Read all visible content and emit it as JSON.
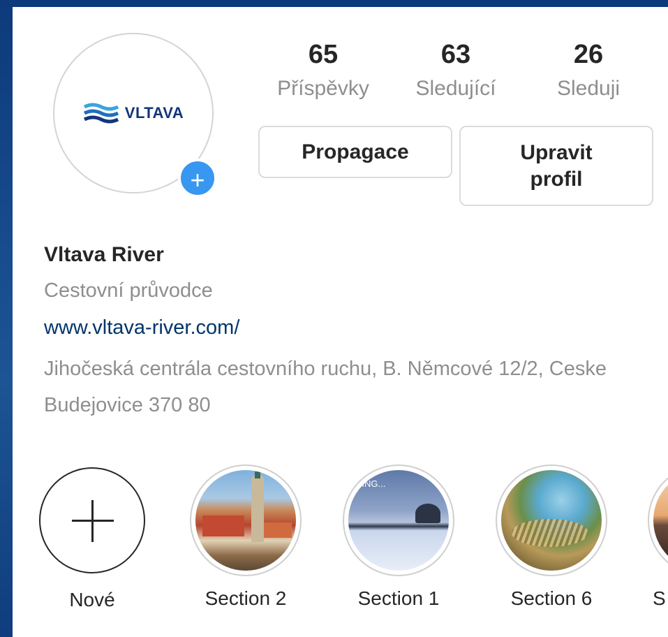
{
  "profile": {
    "logo_text": "VLTAVA",
    "name": "Vltava River",
    "category": "Cestovní průvodce",
    "website": "www.vltava-river.com/",
    "address": "Jihočeská centrála cestovního ruchu, B. Němcové 12/2, Ceske Budejovice 370 80"
  },
  "stats": [
    {
      "value": "65",
      "label": "Příspěvky"
    },
    {
      "value": "63",
      "label": "Sledující"
    },
    {
      "value": "26",
      "label": "Sleduji"
    }
  ],
  "buttons": {
    "promote": "Propagace",
    "edit_profile": "Upravit profil"
  },
  "highlights": [
    {
      "label": "Nové",
      "icon": "plus-icon"
    },
    {
      "label": "Section 2"
    },
    {
      "label": "Section 1",
      "overlay_text": "HING..."
    },
    {
      "label": "Section 6"
    },
    {
      "label": "S"
    }
  ],
  "colors": {
    "accent_blue": "#3897f0",
    "link": "#003569",
    "muted": "#8e8e8e",
    "text": "#262626"
  }
}
